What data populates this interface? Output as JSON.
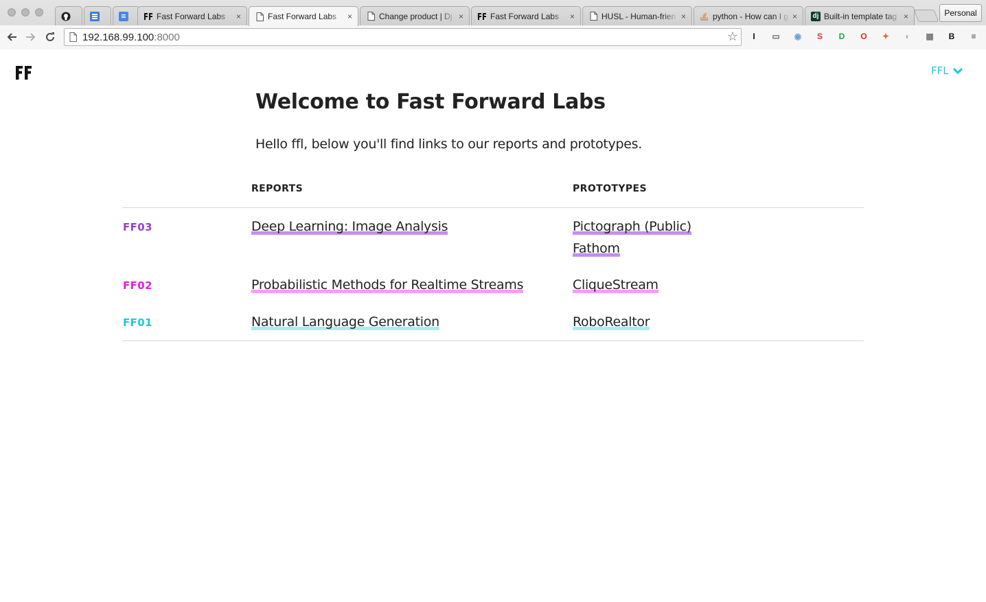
{
  "browser": {
    "tabs": [
      {
        "title": "",
        "icon": "github-icon",
        "active": false
      },
      {
        "title": "",
        "icon": "blue-app-icon",
        "active": false
      },
      {
        "title": "",
        "icon": "google-docs-icon",
        "active": false
      },
      {
        "title": "Fast Forward Labs",
        "icon": "ff-favicon",
        "active": false
      },
      {
        "title": "Fast Forward Labs",
        "icon": "page-icon",
        "active": true
      },
      {
        "title": "Change product | Dj",
        "icon": "page-icon",
        "active": false
      },
      {
        "title": "Fast Forward Labs",
        "icon": "ff-favicon",
        "active": false
      },
      {
        "title": "HUSL - Human-frien",
        "icon": "page-icon",
        "active": false
      },
      {
        "title": "python - How can I g",
        "icon": "stackoverflow-icon",
        "active": false
      },
      {
        "title": "Built-in template tag",
        "icon": "django-icon",
        "active": false
      }
    ],
    "tab_close_glyph": "×",
    "profile_label": "Personal",
    "url_host": "192.168.99.100",
    "url_port": ":8000",
    "extensions": [
      {
        "name": "instapaper-icon",
        "glyph": "I",
        "color": "#111111"
      },
      {
        "name": "cast-icon",
        "glyph": "▭",
        "color": "#666666"
      },
      {
        "name": "camera-icon",
        "glyph": "◉",
        "color": "#6ba0d8"
      },
      {
        "name": "s-extension-icon",
        "glyph": "S",
        "color": "#d83333"
      },
      {
        "name": "green-d-icon",
        "glyph": "D",
        "color": "#1aa34a"
      },
      {
        "name": "opera-icon",
        "glyph": "O",
        "color": "#e3262b"
      },
      {
        "name": "bird-extension-icon",
        "glyph": "✦",
        "color": "#e8642c"
      },
      {
        "name": "moon-extension-icon",
        "glyph": "◐",
        "color": "#aaaaaa"
      },
      {
        "name": "film-icon",
        "glyph": "▦",
        "color": "#777777"
      },
      {
        "name": "b-extension-icon",
        "glyph": "B",
        "color": "#111111"
      }
    ]
  },
  "site": {
    "user_menu_label": "FFL",
    "title": "Welcome to Fast Forward Labs",
    "intro": "Hello ffl, below you'll find links to our reports and prototypes.",
    "columns": {
      "reports": "REPORTS",
      "prototypes": "PROTOTYPES"
    },
    "rows": [
      {
        "code": "FF03",
        "code_color": "#9a3fc9",
        "report": "Deep Learning: Image Analysis",
        "prototypes": [
          "Pictograph (Public)",
          "Fathom"
        ]
      },
      {
        "code": "FF02",
        "code_color": "#e21fd8",
        "report": "Probabilistic Methods for Realtime Streams",
        "prototypes": [
          "CliqueStream"
        ]
      },
      {
        "code": "FF01",
        "code_color": "#1ec8d8",
        "report": "Natural Language Generation",
        "prototypes": [
          "RoboRealtor"
        ]
      }
    ]
  }
}
